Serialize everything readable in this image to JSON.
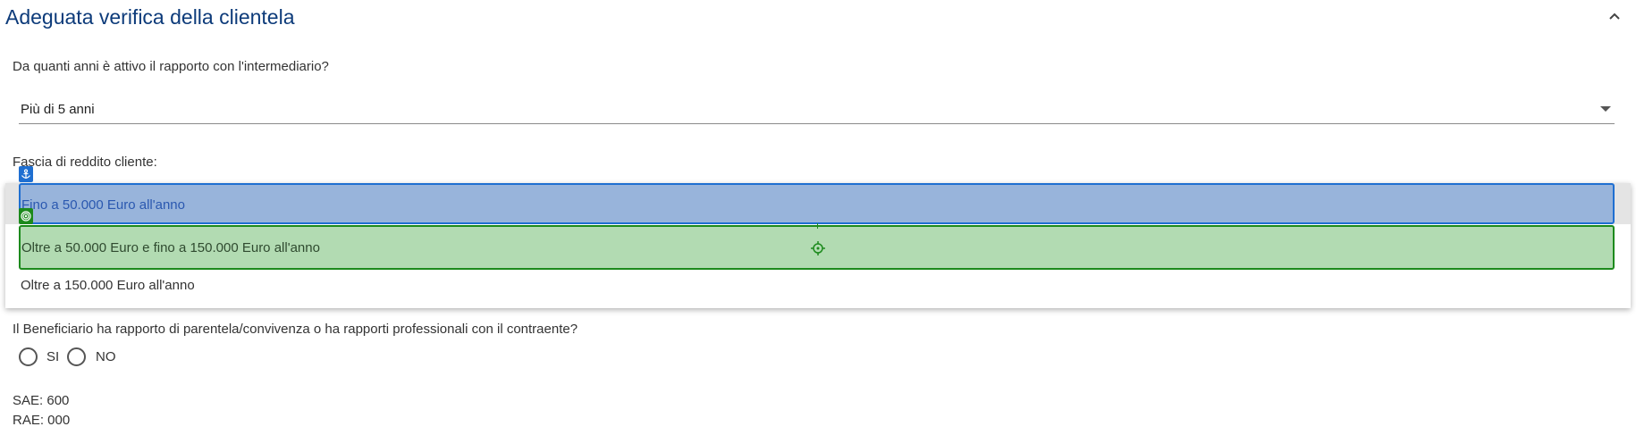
{
  "section": {
    "title": "Adeguata verifica della clientela",
    "collapse_icon": "chevron-up-icon"
  },
  "q_rapporto": {
    "label": "Da quanti anni è attivo il rapporto con l'intermediario?",
    "selected_value": "Più di 5 anni",
    "caret_icon": "caret-down-icon"
  },
  "q_reddito": {
    "label": "Fascia di reddito cliente:",
    "options": [
      "Fino a 50.000 Euro all'anno",
      "Oltre a 50.000 Euro e fino a 150.000 Euro all'anno",
      "Oltre a 150.000 Euro all'anno"
    ],
    "anchor_icon": "anchor-icon",
    "target_icon": "target-icon",
    "crosshair_icon": "crosshair-icon"
  },
  "q_beneficiario": {
    "label": "Il Beneficiario ha rapporto di parentela/convivenza o ha rapporti professionali con il contraente?",
    "options": [
      "SI",
      "NO"
    ]
  },
  "info": {
    "sae": "SAE: 600",
    "rae": "RAE: 000"
  },
  "colors": {
    "title": "#0d3b7a",
    "anchor_highlight": "#1f6fd1",
    "target_highlight": "#1c8a1c"
  }
}
